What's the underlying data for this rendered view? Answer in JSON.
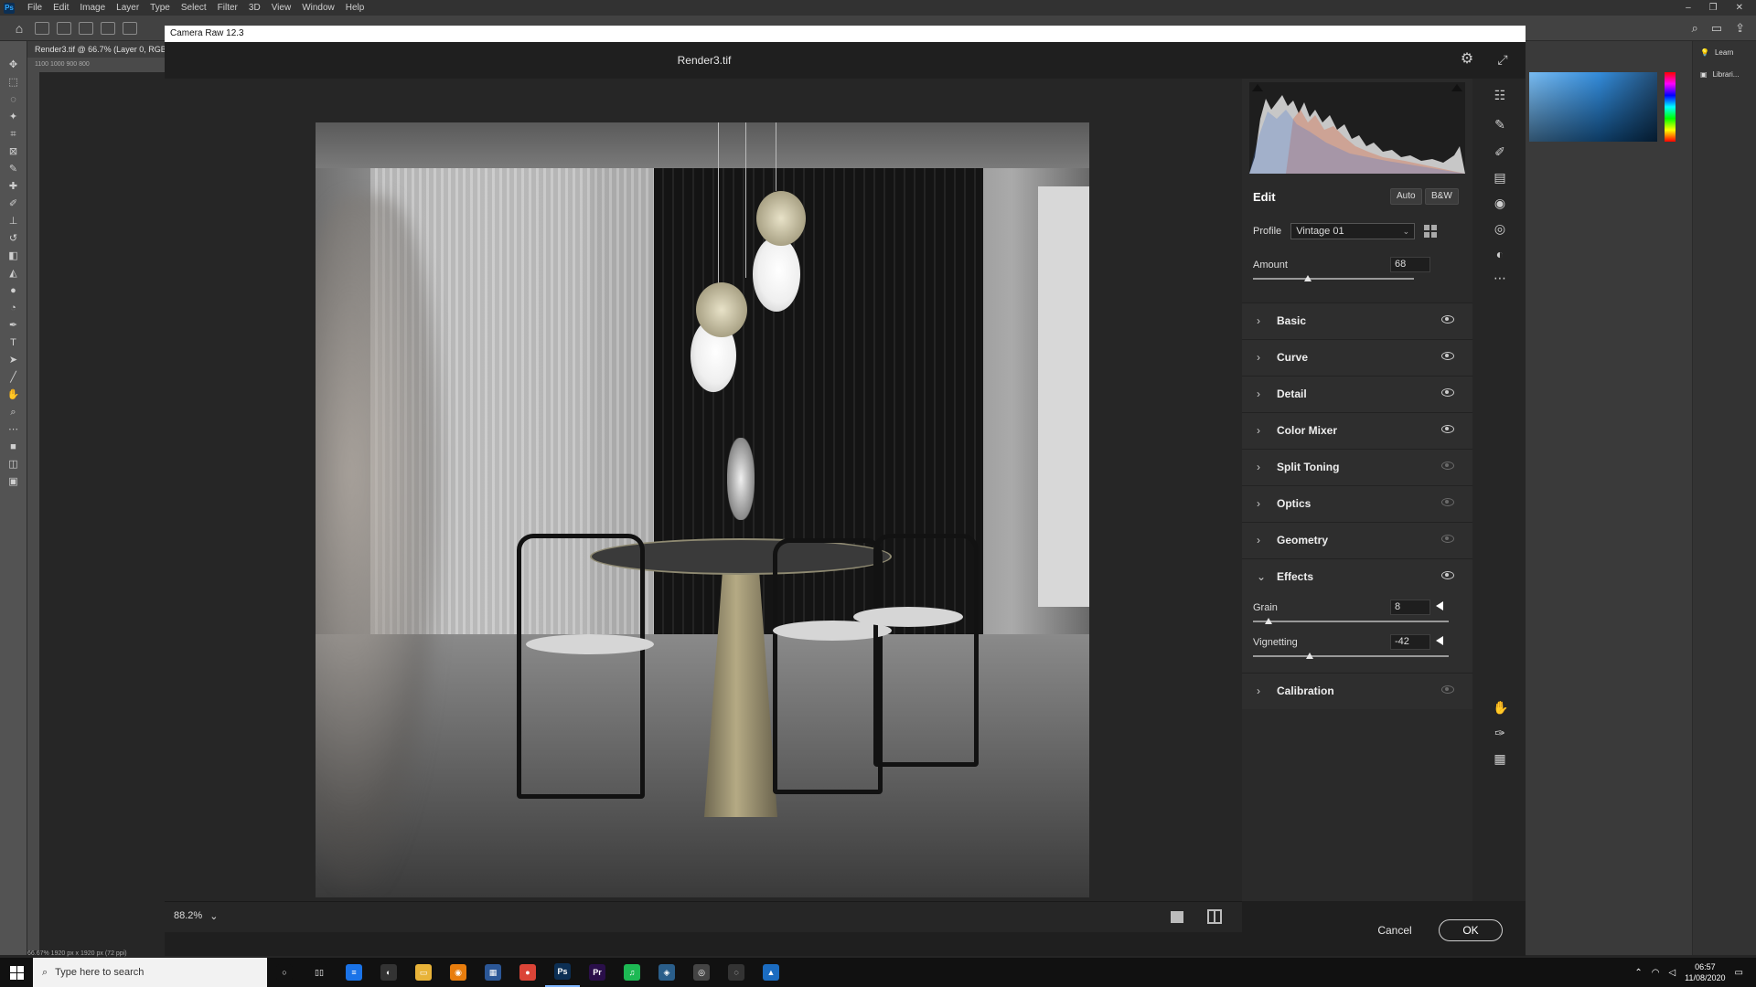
{
  "ps": {
    "logo": "Ps",
    "menu": [
      "File",
      "Edit",
      "Image",
      "Layer",
      "Type",
      "Select",
      "Filter",
      "3D",
      "View",
      "Window",
      "Help"
    ],
    "doc_tab": "Render3.tif @ 66.7% (Layer 0, RGB/8",
    "ruler_marks": "1100    1000    900    800",
    "status": "66.67%      1920 px x 1920 px (72 ppi)",
    "learn_label": "Learn",
    "libraries_label": "Librari...",
    "window_controls": [
      "–",
      "❐",
      "✕"
    ]
  },
  "camera_raw": {
    "window_title": "Camera Raw 12.3",
    "doc_title": "Render3.tif",
    "zoom": "88.2%",
    "zoom_chevron": "⌄",
    "cancel_label": "Cancel",
    "ok_label": "OK",
    "edit": {
      "title": "Edit",
      "auto_label": "Auto",
      "bw_label": "B&W",
      "profile_label": "Profile",
      "profile_value": "Vintage 01",
      "amount_label": "Amount",
      "amount_value": "68",
      "amount_fraction": 0.34
    },
    "sections": [
      {
        "label": "Basic",
        "expanded": false,
        "visible": true
      },
      {
        "label": "Curve",
        "expanded": false,
        "visible": true
      },
      {
        "label": "Detail",
        "expanded": false,
        "visible": true
      },
      {
        "label": "Color Mixer",
        "expanded": false,
        "visible": true
      },
      {
        "label": "Split Toning",
        "expanded": false,
        "visible": false
      },
      {
        "label": "Optics",
        "expanded": false,
        "visible": false
      },
      {
        "label": "Geometry",
        "expanded": false,
        "visible": false
      },
      {
        "label": "Effects",
        "expanded": true,
        "visible": true
      },
      {
        "label": "Calibration",
        "expanded": false,
        "visible": false
      }
    ],
    "effects": {
      "grain_label": "Grain",
      "grain_value": "8",
      "grain_fraction": 0.08,
      "vignetting_label": "Vignetting",
      "vignetting_value": "-42",
      "vignetting_fraction": 0.29
    }
  },
  "taskbar": {
    "search_placeholder": "Type here to search",
    "clock_time": "06:57",
    "clock_date": "11/08/2020",
    "apps": [
      {
        "name": "cortana-app",
        "glyph": "○",
        "color": "#111"
      },
      {
        "name": "task-view-app",
        "glyph": "▯▯",
        "color": "#111"
      },
      {
        "name": "app-3",
        "glyph": "≡",
        "color": "#1a73e8"
      },
      {
        "name": "app-4",
        "glyph": "◐",
        "color": "#333"
      },
      {
        "name": "file-explorer-app",
        "glyph": "▭",
        "color": "#e8b339"
      },
      {
        "name": "blender-app",
        "glyph": "◉",
        "color": "#e87d0d"
      },
      {
        "name": "calculator-app",
        "glyph": "▦",
        "color": "#2b5797"
      },
      {
        "name": "chrome-app",
        "glyph": "●",
        "color": "#db4437"
      },
      {
        "name": "photoshop-app",
        "glyph": "Ps",
        "color": "#0c2f54",
        "active": true
      },
      {
        "name": "premiere-app",
        "glyph": "Pr",
        "color": "#2a0f4a"
      },
      {
        "name": "spotify-app",
        "glyph": "♫",
        "color": "#1db954"
      },
      {
        "name": "app-12",
        "glyph": "◈",
        "color": "#2a5e8a"
      },
      {
        "name": "app-13",
        "glyph": "◎",
        "color": "#444"
      },
      {
        "name": "app-14",
        "glyph": "◌",
        "color": "#333"
      },
      {
        "name": "app-15",
        "glyph": "▲",
        "color": "#1b6cc1"
      }
    ]
  }
}
